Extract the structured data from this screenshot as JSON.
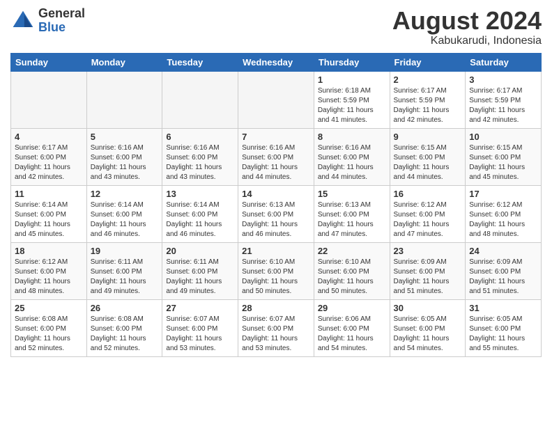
{
  "header": {
    "logo_general": "General",
    "logo_blue": "Blue",
    "month_title": "August 2024",
    "location": "Kabukarudi, Indonesia"
  },
  "days_of_week": [
    "Sunday",
    "Monday",
    "Tuesday",
    "Wednesday",
    "Thursday",
    "Friday",
    "Saturday"
  ],
  "weeks": [
    {
      "days": [
        {
          "number": "",
          "empty": true
        },
        {
          "number": "",
          "empty": true
        },
        {
          "number": "",
          "empty": true
        },
        {
          "number": "",
          "empty": true
        },
        {
          "number": "1",
          "sunrise": "6:18 AM",
          "sunset": "5:59 PM",
          "daylight": "11 hours and 41 minutes."
        },
        {
          "number": "2",
          "sunrise": "6:17 AM",
          "sunset": "5:59 PM",
          "daylight": "11 hours and 42 minutes."
        },
        {
          "number": "3",
          "sunrise": "6:17 AM",
          "sunset": "5:59 PM",
          "daylight": "11 hours and 42 minutes."
        }
      ]
    },
    {
      "days": [
        {
          "number": "4",
          "sunrise": "6:17 AM",
          "sunset": "6:00 PM",
          "daylight": "11 hours and 42 minutes."
        },
        {
          "number": "5",
          "sunrise": "6:16 AM",
          "sunset": "6:00 PM",
          "daylight": "11 hours and 43 minutes."
        },
        {
          "number": "6",
          "sunrise": "6:16 AM",
          "sunset": "6:00 PM",
          "daylight": "11 hours and 43 minutes."
        },
        {
          "number": "7",
          "sunrise": "6:16 AM",
          "sunset": "6:00 PM",
          "daylight": "11 hours and 44 minutes."
        },
        {
          "number": "8",
          "sunrise": "6:16 AM",
          "sunset": "6:00 PM",
          "daylight": "11 hours and 44 minutes."
        },
        {
          "number": "9",
          "sunrise": "6:15 AM",
          "sunset": "6:00 PM",
          "daylight": "11 hours and 44 minutes."
        },
        {
          "number": "10",
          "sunrise": "6:15 AM",
          "sunset": "6:00 PM",
          "daylight": "11 hours and 45 minutes."
        }
      ]
    },
    {
      "days": [
        {
          "number": "11",
          "sunrise": "6:14 AM",
          "sunset": "6:00 PM",
          "daylight": "11 hours and 45 minutes."
        },
        {
          "number": "12",
          "sunrise": "6:14 AM",
          "sunset": "6:00 PM",
          "daylight": "11 hours and 46 minutes."
        },
        {
          "number": "13",
          "sunrise": "6:14 AM",
          "sunset": "6:00 PM",
          "daylight": "11 hours and 46 minutes."
        },
        {
          "number": "14",
          "sunrise": "6:13 AM",
          "sunset": "6:00 PM",
          "daylight": "11 hours and 46 minutes."
        },
        {
          "number": "15",
          "sunrise": "6:13 AM",
          "sunset": "6:00 PM",
          "daylight": "11 hours and 47 minutes."
        },
        {
          "number": "16",
          "sunrise": "6:12 AM",
          "sunset": "6:00 PM",
          "daylight": "11 hours and 47 minutes."
        },
        {
          "number": "17",
          "sunrise": "6:12 AM",
          "sunset": "6:00 PM",
          "daylight": "11 hours and 48 minutes."
        }
      ]
    },
    {
      "days": [
        {
          "number": "18",
          "sunrise": "6:12 AM",
          "sunset": "6:00 PM",
          "daylight": "11 hours and 48 minutes."
        },
        {
          "number": "19",
          "sunrise": "6:11 AM",
          "sunset": "6:00 PM",
          "daylight": "11 hours and 49 minutes."
        },
        {
          "number": "20",
          "sunrise": "6:11 AM",
          "sunset": "6:00 PM",
          "daylight": "11 hours and 49 minutes."
        },
        {
          "number": "21",
          "sunrise": "6:10 AM",
          "sunset": "6:00 PM",
          "daylight": "11 hours and 50 minutes."
        },
        {
          "number": "22",
          "sunrise": "6:10 AM",
          "sunset": "6:00 PM",
          "daylight": "11 hours and 50 minutes."
        },
        {
          "number": "23",
          "sunrise": "6:09 AM",
          "sunset": "6:00 PM",
          "daylight": "11 hours and 51 minutes."
        },
        {
          "number": "24",
          "sunrise": "6:09 AM",
          "sunset": "6:00 PM",
          "daylight": "11 hours and 51 minutes."
        }
      ]
    },
    {
      "days": [
        {
          "number": "25",
          "sunrise": "6:08 AM",
          "sunset": "6:00 PM",
          "daylight": "11 hours and 52 minutes."
        },
        {
          "number": "26",
          "sunrise": "6:08 AM",
          "sunset": "6:00 PM",
          "daylight": "11 hours and 52 minutes."
        },
        {
          "number": "27",
          "sunrise": "6:07 AM",
          "sunset": "6:00 PM",
          "daylight": "11 hours and 53 minutes."
        },
        {
          "number": "28",
          "sunrise": "6:07 AM",
          "sunset": "6:00 PM",
          "daylight": "11 hours and 53 minutes."
        },
        {
          "number": "29",
          "sunrise": "6:06 AM",
          "sunset": "6:00 PM",
          "daylight": "11 hours and 54 minutes."
        },
        {
          "number": "30",
          "sunrise": "6:05 AM",
          "sunset": "6:00 PM",
          "daylight": "11 hours and 54 minutes."
        },
        {
          "number": "31",
          "sunrise": "6:05 AM",
          "sunset": "6:00 PM",
          "daylight": "11 hours and 55 minutes."
        }
      ]
    }
  ],
  "labels": {
    "sunrise": "Sunrise:",
    "sunset": "Sunset:",
    "daylight": "Daylight:"
  }
}
